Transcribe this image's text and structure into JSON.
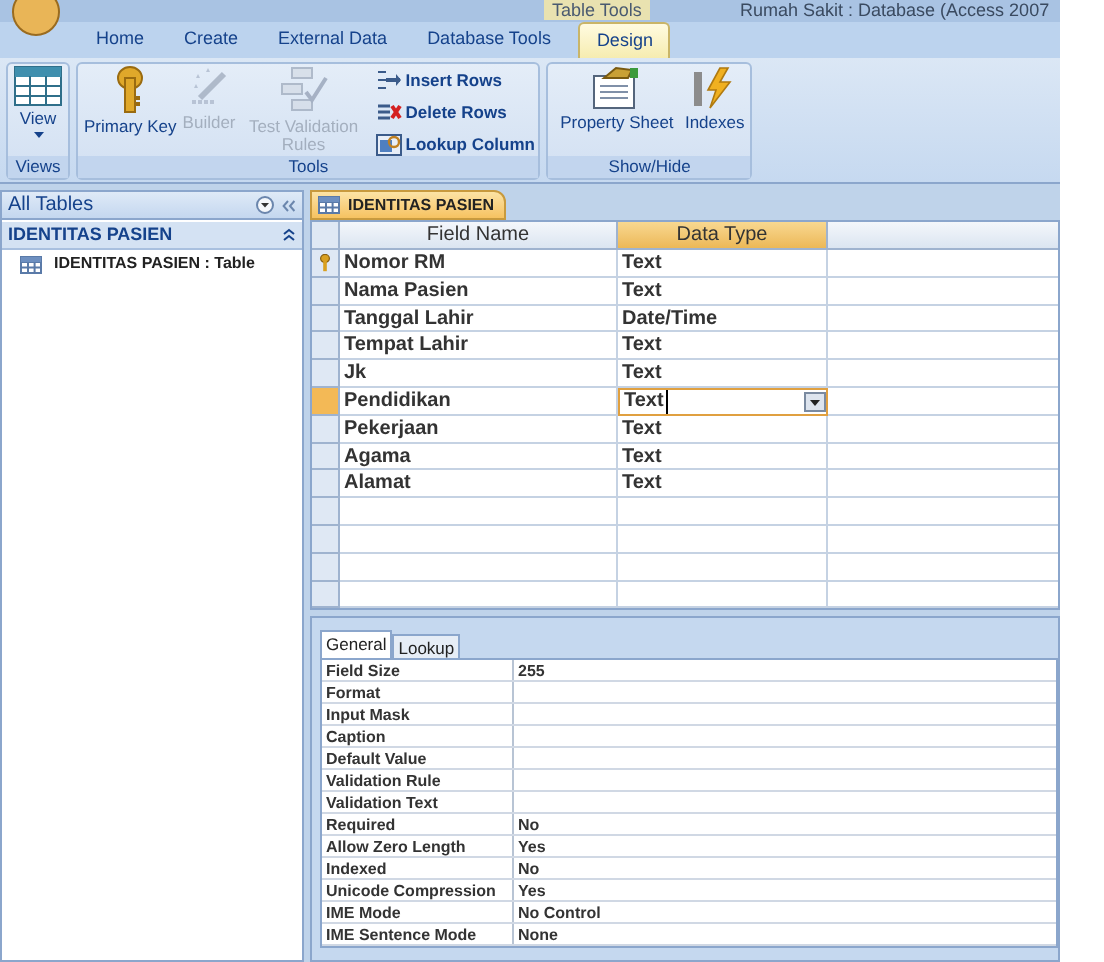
{
  "title_bar": {
    "contextual_tab": "Table Tools",
    "title": "Rumah Sakit : Database (Access 2007"
  },
  "ribbon_tabs": [
    {
      "label": "Home",
      "selected": false
    },
    {
      "label": "Create",
      "selected": false
    },
    {
      "label": "External Data",
      "selected": false
    },
    {
      "label": "Database Tools",
      "selected": false
    },
    {
      "label": "Design",
      "selected": true
    }
  ],
  "ribbon_groups": [
    {
      "label": "Views",
      "buttons": [
        {
          "label": "View",
          "kind": "large",
          "disabled": false,
          "dropdown": true
        }
      ]
    },
    {
      "label": "Tools",
      "buttons": [
        {
          "label": "Primary Key",
          "kind": "large",
          "disabled": false
        },
        {
          "label": "Builder",
          "kind": "large",
          "disabled": true
        },
        {
          "label": "Test Validation Rules",
          "kind": "large",
          "disabled": true
        },
        {
          "label": "Insert Rows",
          "kind": "small",
          "disabled": false
        },
        {
          "label": "Delete Rows",
          "kind": "small",
          "disabled": false
        },
        {
          "label": "Lookup Column",
          "kind": "small",
          "disabled": false
        }
      ]
    },
    {
      "label": "Show/Hide",
      "buttons": [
        {
          "label": "Property Sheet",
          "kind": "large",
          "disabled": false
        },
        {
          "label": "Indexes",
          "kind": "large",
          "disabled": false
        }
      ]
    }
  ],
  "nav_pane": {
    "title": "All Tables",
    "group": {
      "label": "IDENTITAS PASIEN",
      "expanded": true,
      "items": [
        {
          "label": "IDENTITAS PASIEN : Table"
        }
      ]
    }
  },
  "document_tab": {
    "label": "IDENTITAS PASIEN"
  },
  "design_grid": {
    "columns": [
      {
        "label": "Field Name",
        "selected": false
      },
      {
        "label": "Data Type",
        "selected": true
      }
    ],
    "rows": [
      {
        "field_name": "Nomor RM",
        "data_type": "Text",
        "primary_key": true,
        "selected": false
      },
      {
        "field_name": "Nama Pasien",
        "data_type": "Text",
        "primary_key": false,
        "selected": false
      },
      {
        "field_name": "Tanggal Lahir",
        "data_type": "Date/Time",
        "primary_key": false,
        "selected": false
      },
      {
        "field_name": "Tempat Lahir",
        "data_type": "Text",
        "primary_key": false,
        "selected": false
      },
      {
        "field_name": "Jk",
        "data_type": "Text",
        "primary_key": false,
        "selected": false
      },
      {
        "field_name": "Pendidikan",
        "data_type": "Text",
        "primary_key": false,
        "selected": true
      },
      {
        "field_name": "Pekerjaan",
        "data_type": "Text",
        "primary_key": false,
        "selected": false
      },
      {
        "field_name": "Agama",
        "data_type": "Text",
        "primary_key": false,
        "selected": false
      },
      {
        "field_name": "Alamat",
        "data_type": "Text",
        "primary_key": false,
        "selected": false
      }
    ]
  },
  "property_sheet": {
    "tabs": [
      {
        "label": "General",
        "selected": true
      },
      {
        "label": "Lookup",
        "selected": false
      }
    ],
    "rows": [
      {
        "name": "Field Size",
        "value": "255"
      },
      {
        "name": "Format"
      },
      {
        "name": "Input Mask"
      },
      {
        "name": "Caption"
      },
      {
        "name": "Default Value"
      },
      {
        "name": "Validation Rule"
      },
      {
        "name": "Validation Text"
      },
      {
        "name": "Required",
        "value": "No"
      },
      {
        "name": "Allow Zero Length",
        "value": "Yes"
      },
      {
        "name": "Indexed",
        "value": "No"
      },
      {
        "name": "Unicode Compression",
        "value": "Yes"
      },
      {
        "name": "IME Mode",
        "value": "No Control"
      },
      {
        "name": "IME Sentence Mode",
        "value": "None"
      }
    ]
  }
}
